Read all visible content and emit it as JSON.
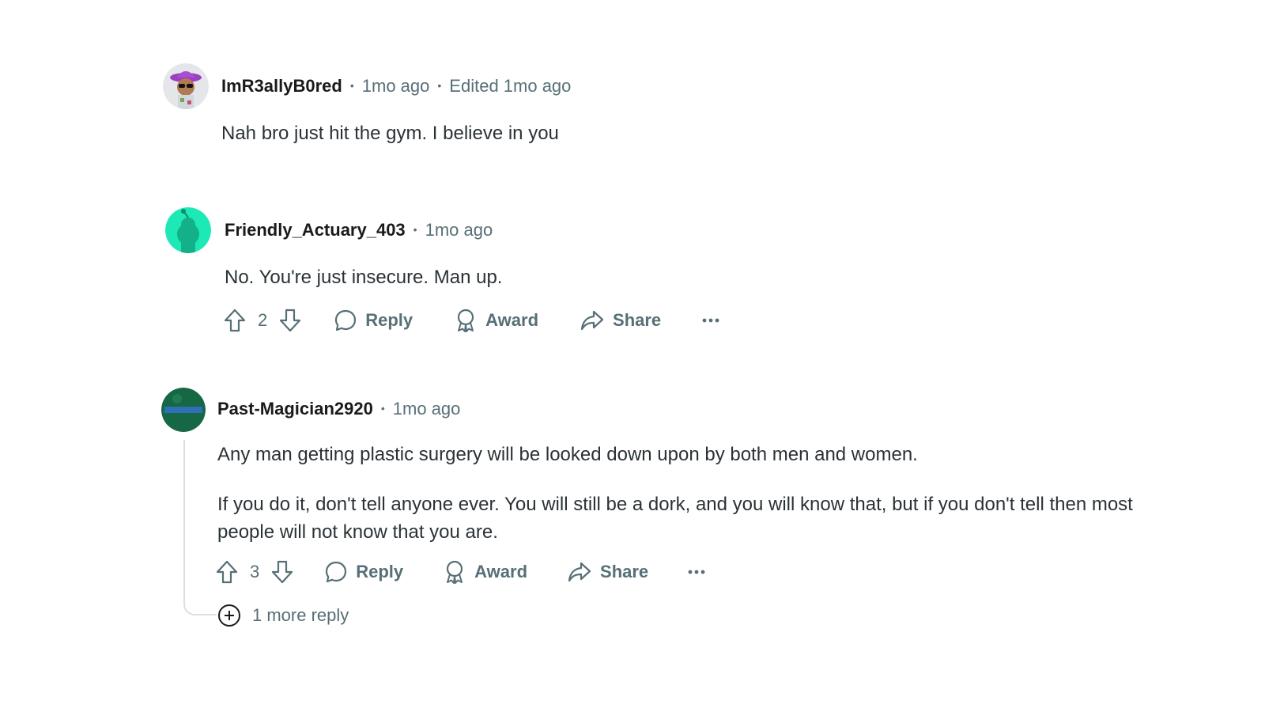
{
  "comments": [
    {
      "username": "ImR3allyB0red",
      "time": "1mo ago",
      "edited": "Edited 1mo ago",
      "body": [
        "Nah bro just hit the gym. I believe in you"
      ]
    },
    {
      "username": "Friendly_Actuary_403",
      "time": "1mo ago",
      "body": [
        "No. You're just insecure. Man up."
      ],
      "votes": "2",
      "reply_label": "Reply",
      "award_label": "Award",
      "share_label": "Share"
    },
    {
      "username": "Past-Magician2920",
      "time": "1mo ago",
      "body": [
        "Any man getting plastic surgery will be looked down upon by both men and women.",
        "If you do it, don't tell anyone ever. You will still be a dork, and you will know that, but if you don't tell then most people will not know that you are."
      ],
      "votes": "3",
      "reply_label": "Reply",
      "award_label": "Award",
      "share_label": "Share",
      "more_replies": "1 more reply"
    }
  ],
  "icons": {
    "upvote": "upvote-arrow-icon",
    "downvote": "downvote-arrow-icon",
    "reply": "speech-bubble-icon",
    "award": "award-ribbon-icon",
    "share": "share-arrow-icon",
    "more": "ellipsis-icon",
    "expand": "plus-circle-icon"
  },
  "colors": {
    "meta_text": "#576f76",
    "avatar_teal": "#1de9b6",
    "avatar_green": "#1b6e4a",
    "avatar_purple": "#9b3fbf"
  }
}
